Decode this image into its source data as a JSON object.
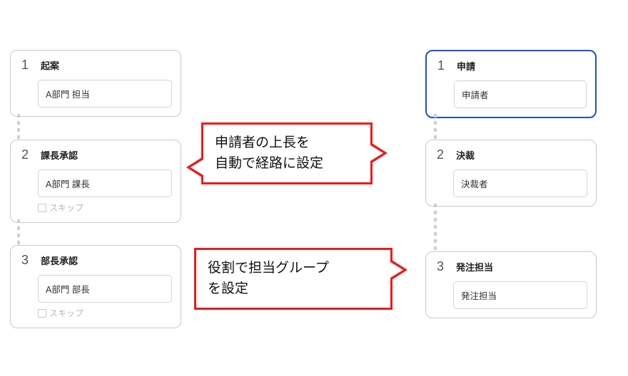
{
  "left_flow": {
    "steps": [
      {
        "num": "1",
        "title": "起案",
        "person": "A部門 担当",
        "skip": null
      },
      {
        "num": "2",
        "title": "課長承認",
        "person": "A部門 課長",
        "skip": "スキップ"
      },
      {
        "num": "3",
        "title": "部長承認",
        "person": "A部門 部長",
        "skip": "スキップ"
      }
    ]
  },
  "right_flow": {
    "steps": [
      {
        "num": "1",
        "title": "申請",
        "person": "申請者",
        "selected": true
      },
      {
        "num": "2",
        "title": "決裁",
        "person": "決裁者",
        "selected": false
      },
      {
        "num": "3",
        "title": "発注担当",
        "person": "発注担当",
        "selected": false
      }
    ]
  },
  "callouts": {
    "c1": {
      "line1": "申請者の上長を",
      "line2": "自動で経路に設定"
    },
    "c2": {
      "line1": "役割で担当グループ",
      "line2": "を設定"
    }
  }
}
